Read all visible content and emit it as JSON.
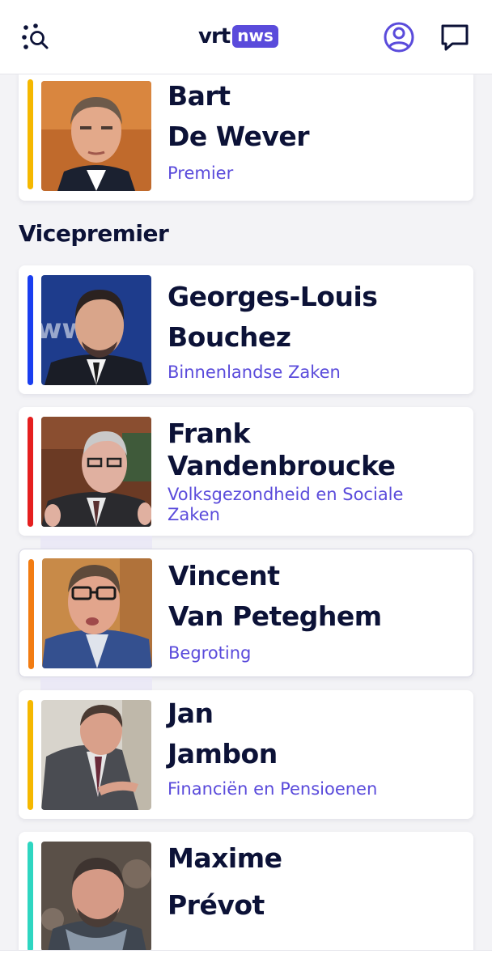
{
  "header": {
    "logo_vrt": "vrt",
    "logo_nws": "nws",
    "icons": {
      "search": "search-dots-icon",
      "account": "user-circle-icon",
      "comments": "speech-bubble-icon"
    },
    "accent_color": "#5a4bdb"
  },
  "premier_card": {
    "first_name": "Bart",
    "last_name": "De Wever",
    "role": "Premier",
    "bar_color": "#f5b800"
  },
  "section": {
    "title": "Vicepremier"
  },
  "ministers": [
    {
      "first_name": "Georges-Louis",
      "last_name": "Bouchez",
      "role": "Binnenlandse Zaken",
      "bar_color": "#1a3ef0"
    },
    {
      "first_name": "Frank",
      "last_name": "Vandenbroucke",
      "role_line1": "Volksgezondheid en Sociale",
      "role_line2": "Zaken",
      "bar_color": "#e51f1f"
    },
    {
      "first_name": "Vincent",
      "last_name": "Van Peteghem",
      "role": "Begroting",
      "bar_color": "#f27c12"
    },
    {
      "first_name": "Jan",
      "last_name": "Jambon",
      "role": "Financiën en Pensioenen",
      "bar_color": "#f5b800"
    },
    {
      "first_name": "Maxime",
      "last_name": "Prévot",
      "bar_color": "#2ed6c1"
    }
  ]
}
